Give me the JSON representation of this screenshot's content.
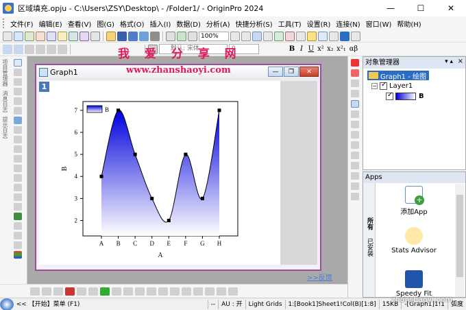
{
  "window": {
    "title": "区域填充.opju - C:\\Users\\ZSY\\Desktop\\ - /Folder1/ - OriginPro 2024",
    "minimize": "—",
    "maximize": "☐",
    "close": "✕"
  },
  "menu": [
    "文件(F)",
    "编辑(E)",
    "查看(V)",
    "图(G)",
    "格式(O)",
    "插入(I)",
    "数据(D)",
    "分析(A)",
    "快捷分析(S)",
    "工具(T)",
    "设置(R)",
    "连接(N)",
    "窗口(W)",
    "帮助(H)"
  ],
  "toolbar": {
    "zoom": "100%",
    "font": "默认: 宋体",
    "font_size": "0",
    "format_buttons": [
      "B",
      "I",
      "U",
      "x²",
      "x₂",
      "x²₁",
      "αβ"
    ]
  },
  "overlay": {
    "watermark": "我 爱 分 享 网",
    "url": "www.zhanshaoyi.com",
    "footer_url": "zhanshaoyi.com"
  },
  "left_panel_tabs": [
    "项目管理器",
    "消息日志",
    "提示日志"
  ],
  "graph_window": {
    "title": "Graph1",
    "layer_number": "1",
    "buttons": {
      "minimize": "—",
      "restore": "❐",
      "close": "✕"
    }
  },
  "feedback_link": ">>反馈",
  "object_manager": {
    "title": "对象管理器",
    "pin": "▾ ▴",
    "close": "×",
    "graph_node": "Graph1 - 绘图",
    "layer_node": "Layer1",
    "plot_node": "B",
    "expand": "−"
  },
  "apps": {
    "title": "Apps",
    "tabs": [
      "所有",
      "已安装"
    ],
    "items": [
      "添加App",
      "Stats Advisor",
      "Speedy Fit"
    ]
  },
  "status": {
    "start": "<<  【开始】菜单 (F1)",
    "dashes": "--",
    "au": "AU : 开",
    "grid": "Light Grids",
    "col": "1:[Book1]Sheet1!Col(B)[1:8]",
    "mem": "15KB",
    "graph": "-[Graph1]1!1",
    "unit": "弧度"
  },
  "colors": {
    "fill_top": "#0000dd",
    "fill_bottom": "#ffffff",
    "line": "#000000",
    "accent": "#2b6cc4",
    "graph_border": "#9b4ea0"
  },
  "chart_data": {
    "type": "area",
    "categories": [
      "A",
      "B",
      "C",
      "D",
      "E",
      "F",
      "G",
      "H"
    ],
    "values": [
      4,
      7,
      5,
      3,
      2,
      5,
      3,
      7
    ],
    "xlabel": "A",
    "ylabel": "B",
    "yticks": [
      2,
      3,
      4,
      5,
      6,
      7
    ],
    "ylim": [
      1.3,
      7.4
    ],
    "legend": {
      "label": "B",
      "placement": "top-left"
    },
    "smooth": true,
    "fill": "vertical gradient blue to white below curve"
  }
}
